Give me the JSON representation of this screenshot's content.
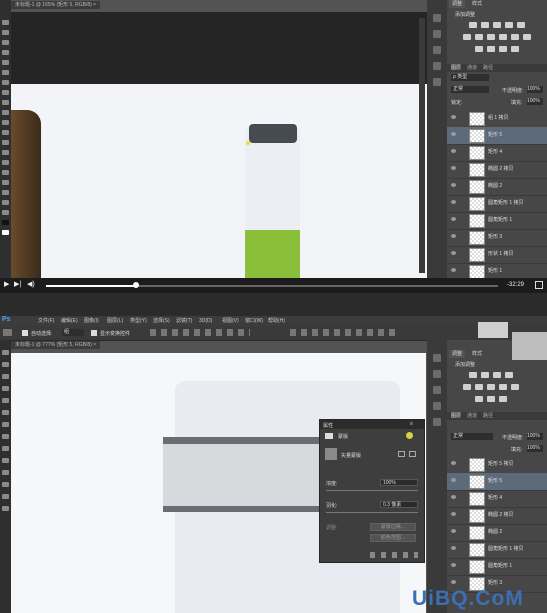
{
  "top": {
    "doc_tab": "未标题-1 @ 165% (矩形 5, RGB/8) ×",
    "panel_tabs": [
      "调整",
      "样式"
    ],
    "adjust_title": "添加调整",
    "layers_tabs": [
      "图层",
      "通道",
      "路径"
    ],
    "kind_label": "ρ 类型",
    "blend_mode": "正常",
    "opacity_label": "不透明度:",
    "opacity_value": "100%",
    "lock_label": "锁定:",
    "fill_label": "填充:",
    "fill_value": "100%",
    "layers": [
      {
        "name": "组 1 拷贝",
        "selected": false
      },
      {
        "name": "矩形 5",
        "selected": true
      },
      {
        "name": "矩形 4",
        "selected": false
      },
      {
        "name": "椭圆 2 拷贝",
        "selected": false
      },
      {
        "name": "椭圆 2",
        "selected": false
      },
      {
        "name": "圆角矩形 1 拷贝",
        "selected": false
      },
      {
        "name": "圆角矩形 1",
        "selected": false
      },
      {
        "name": "矩形 3",
        "selected": false
      },
      {
        "name": "形状 1 拷贝",
        "selected": false
      },
      {
        "name": "矩形 1",
        "selected": false
      }
    ],
    "video_time": "-32:29",
    "video_progress": 0.2
  },
  "bottom": {
    "menu": [
      "文件(F)",
      "编辑(E)",
      "图像(I)",
      "图层(L)",
      "类型(Y)",
      "选择(S)",
      "滤镜(T)",
      "3D(D)",
      "视图(V)",
      "窗口(W)",
      "帮助(H)"
    ],
    "auto_select": "自动选择:",
    "auto_select_value": "组",
    "show_transform": "显示变换控件",
    "doc_tab": "未标题-1 @ 777% (矩形 5, RGB/8) ×",
    "panel_tabs": [
      "调整",
      "样式"
    ],
    "adjust_title": "添加调整",
    "layers_tabs": [
      "图层",
      "通道",
      "路径"
    ],
    "blend_mode": "正常",
    "opacity_label": "不透明度:",
    "opacity_value": "100%",
    "fill_label": "填充:",
    "fill_value": "100%",
    "layers": [
      {
        "name": "矩形 5 拷贝",
        "selected": false
      },
      {
        "name": "矩形 5",
        "selected": true
      },
      {
        "name": "矩形 4",
        "selected": false
      },
      {
        "name": "椭圆 2 拷贝",
        "selected": false
      },
      {
        "name": "椭圆 2",
        "selected": false
      },
      {
        "name": "圆角矩形 1 拷贝",
        "selected": false
      },
      {
        "name": "圆角矩形 1",
        "selected": false
      },
      {
        "name": "矩形 3",
        "selected": false
      }
    ],
    "properties": {
      "title": "属性",
      "tab": "蒙版",
      "vector_mask": "矢量蒙版",
      "density_label": "浓度:",
      "density_value": "100%",
      "feather_label": "羽化:",
      "feather_value": "0.3 像素",
      "refine_label": "调整:",
      "btn_edge": "蒙版边缘...",
      "btn_invert": "颜色范围..."
    }
  },
  "watermark": "UiBQ.CoM"
}
